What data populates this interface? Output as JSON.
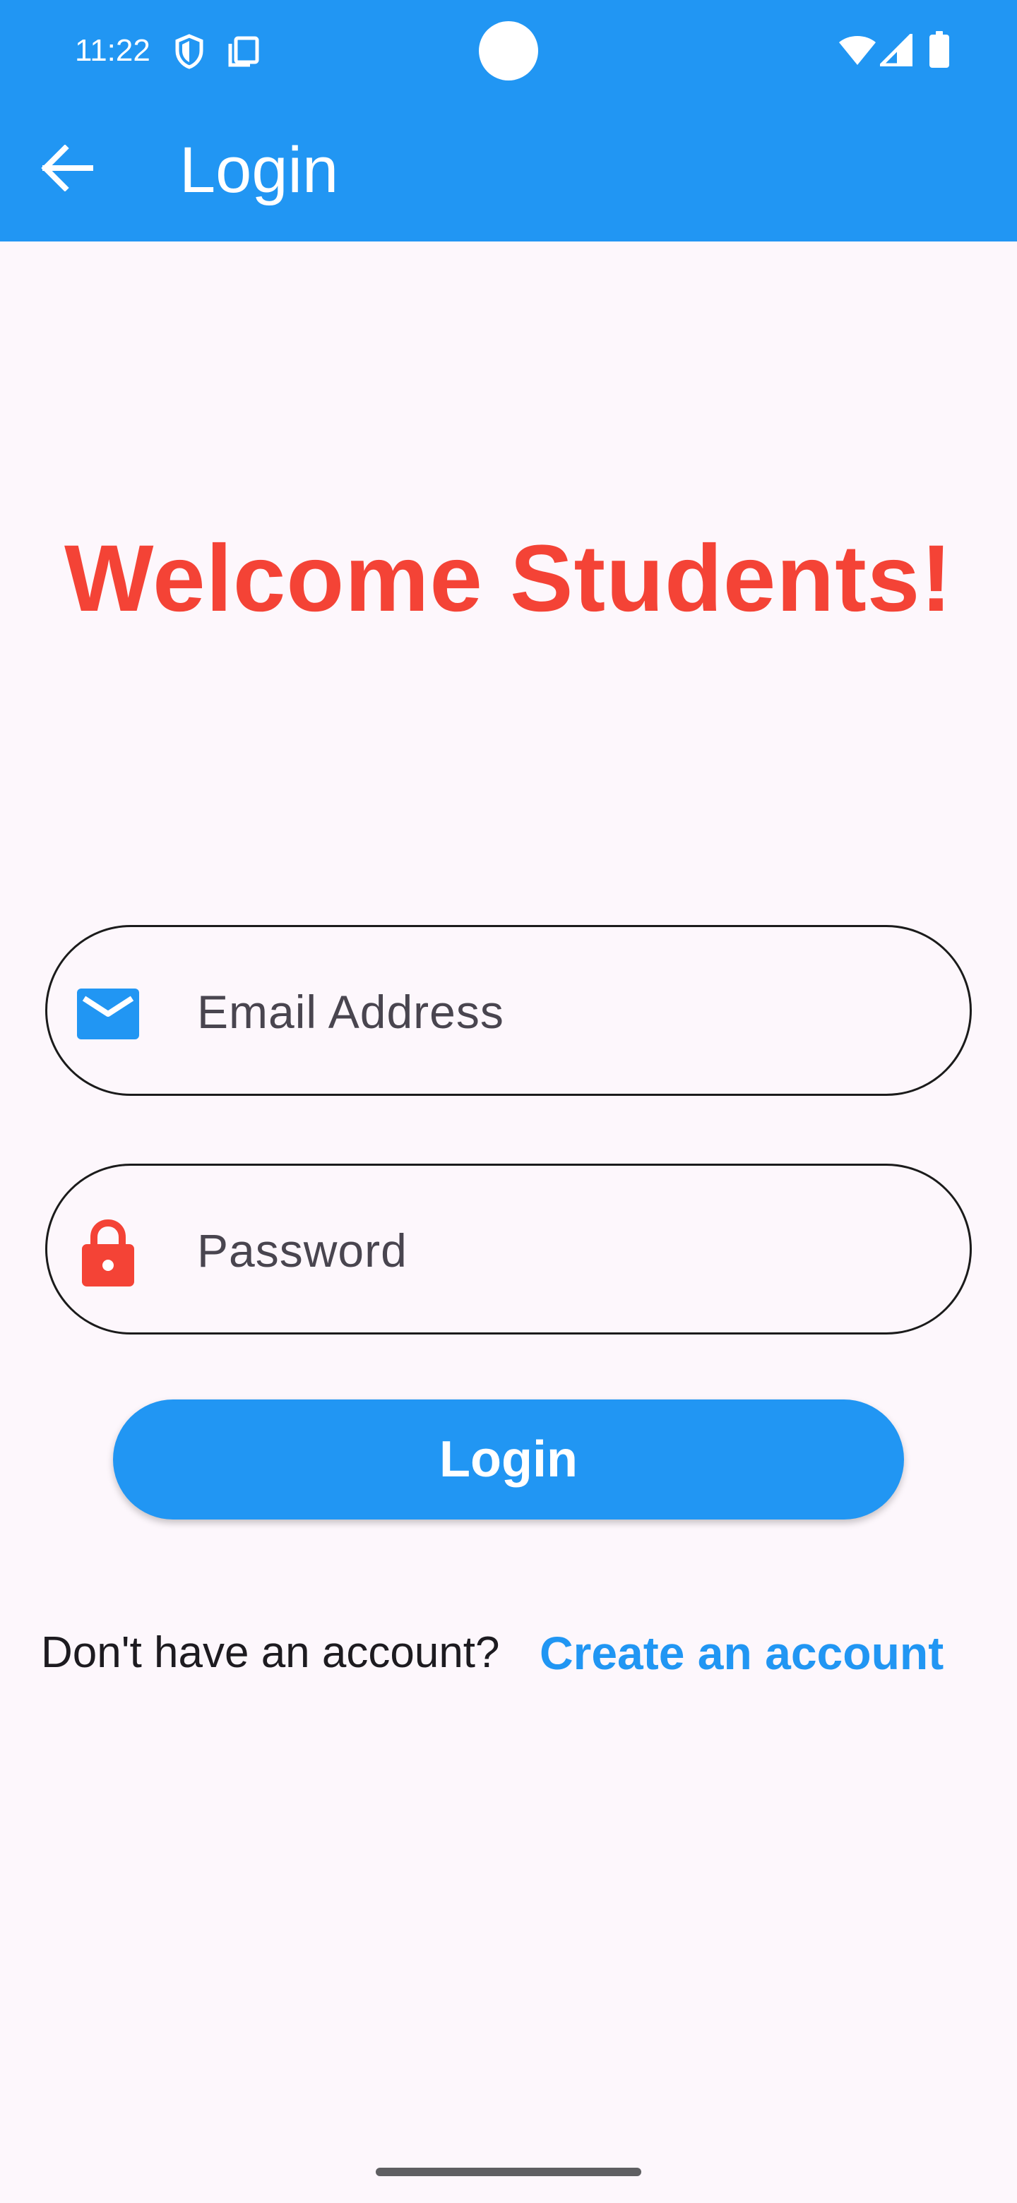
{
  "status_bar": {
    "time": "11:22",
    "icons": [
      "shield-icon",
      "screenshot-icon",
      "wifi-icon",
      "cellular-signal-icon",
      "battery-icon"
    ]
  },
  "app_bar": {
    "title": "Login",
    "back_icon": "arrow-left-icon",
    "background_color": "#2196F3"
  },
  "welcome": {
    "text": "Welcome Students!",
    "color": "#F44336"
  },
  "form": {
    "email": {
      "placeholder": "Email Address",
      "value": "",
      "icon": "mail-icon",
      "icon_color": "#2196F3"
    },
    "password": {
      "placeholder": "Password",
      "value": "",
      "icon": "lock-icon",
      "icon_color": "#F44336"
    },
    "login_button_label": "Login"
  },
  "signup": {
    "prompt": "Don't have an account?",
    "link_label": "Create an account",
    "link_color": "#2196F3"
  },
  "colors": {
    "page_background": "#FDF7FC",
    "primary": "#2196F3",
    "accent_red": "#F44336"
  }
}
